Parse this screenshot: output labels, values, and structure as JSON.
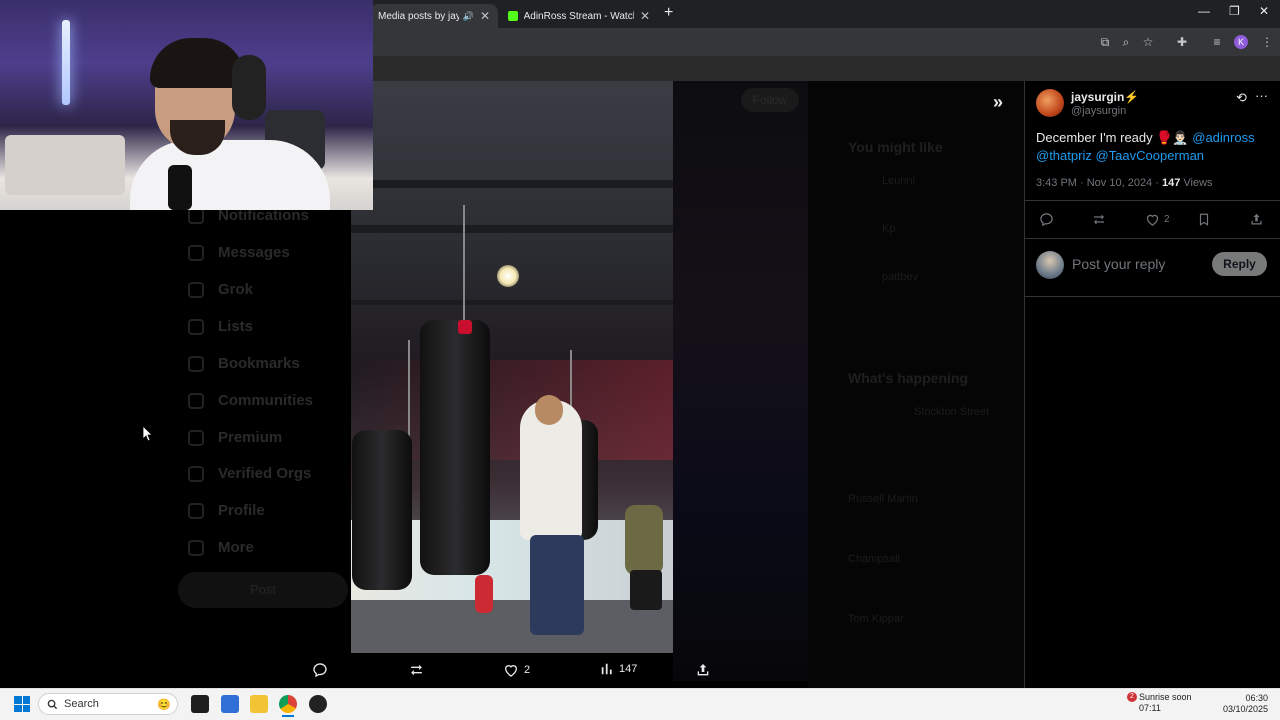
{
  "browser": {
    "tabs": [
      {
        "title": "Media posts by jaysurgi",
        "active": true
      },
      {
        "title": "AdinRoss Stream - Watch Live o",
        "active": false
      }
    ],
    "new_tab": "+",
    "profile_initial": "K"
  },
  "background": {
    "nav_items": [
      "Notifications",
      "Messages",
      "Grok",
      "Lists",
      "Bookmarks",
      "Communities",
      "Premium",
      "Verified Orgs",
      "Profile",
      "More"
    ],
    "post_button": "Post",
    "follow_button": "Follow",
    "you_might_like": "You might like",
    "suggestions": [
      "Leunni",
      "Kp",
      "pattbev"
    ],
    "whats_happening": "What's happening",
    "trends": [
      "Stockton Street",
      "Russell Martin",
      "Champsall",
      "Tom Kippar"
    ]
  },
  "media_actions": {
    "likes": "2",
    "views": "147"
  },
  "tweet": {
    "display_name": "jaysurgin⚡",
    "handle": "@jaysurgin",
    "text_prefix": "December I'm ready 🥊👨🏻‍⚕️",
    "mention1": "@adinross",
    "mention2": "@thatpriz",
    "mention3": "@TaavCooperman",
    "meta_time": "3:43 PM · Nov 10, 2024 · ",
    "views_count": "147",
    "views_label": " Views",
    "like_count": "2",
    "reply_placeholder": "Post your reply",
    "reply_button": "Reply"
  },
  "taskbar": {
    "search_placeholder": "Search",
    "weather_title": "Sunrise soon",
    "weather_time": "07:11",
    "weather_badge": "2",
    "time": "06:30",
    "date": "03/10/2025"
  },
  "colors": {
    "accent": "#1d9bf0",
    "text_primary": "#e7e9ea",
    "text_secondary": "#71767b",
    "kick_green": "#53fc18"
  }
}
